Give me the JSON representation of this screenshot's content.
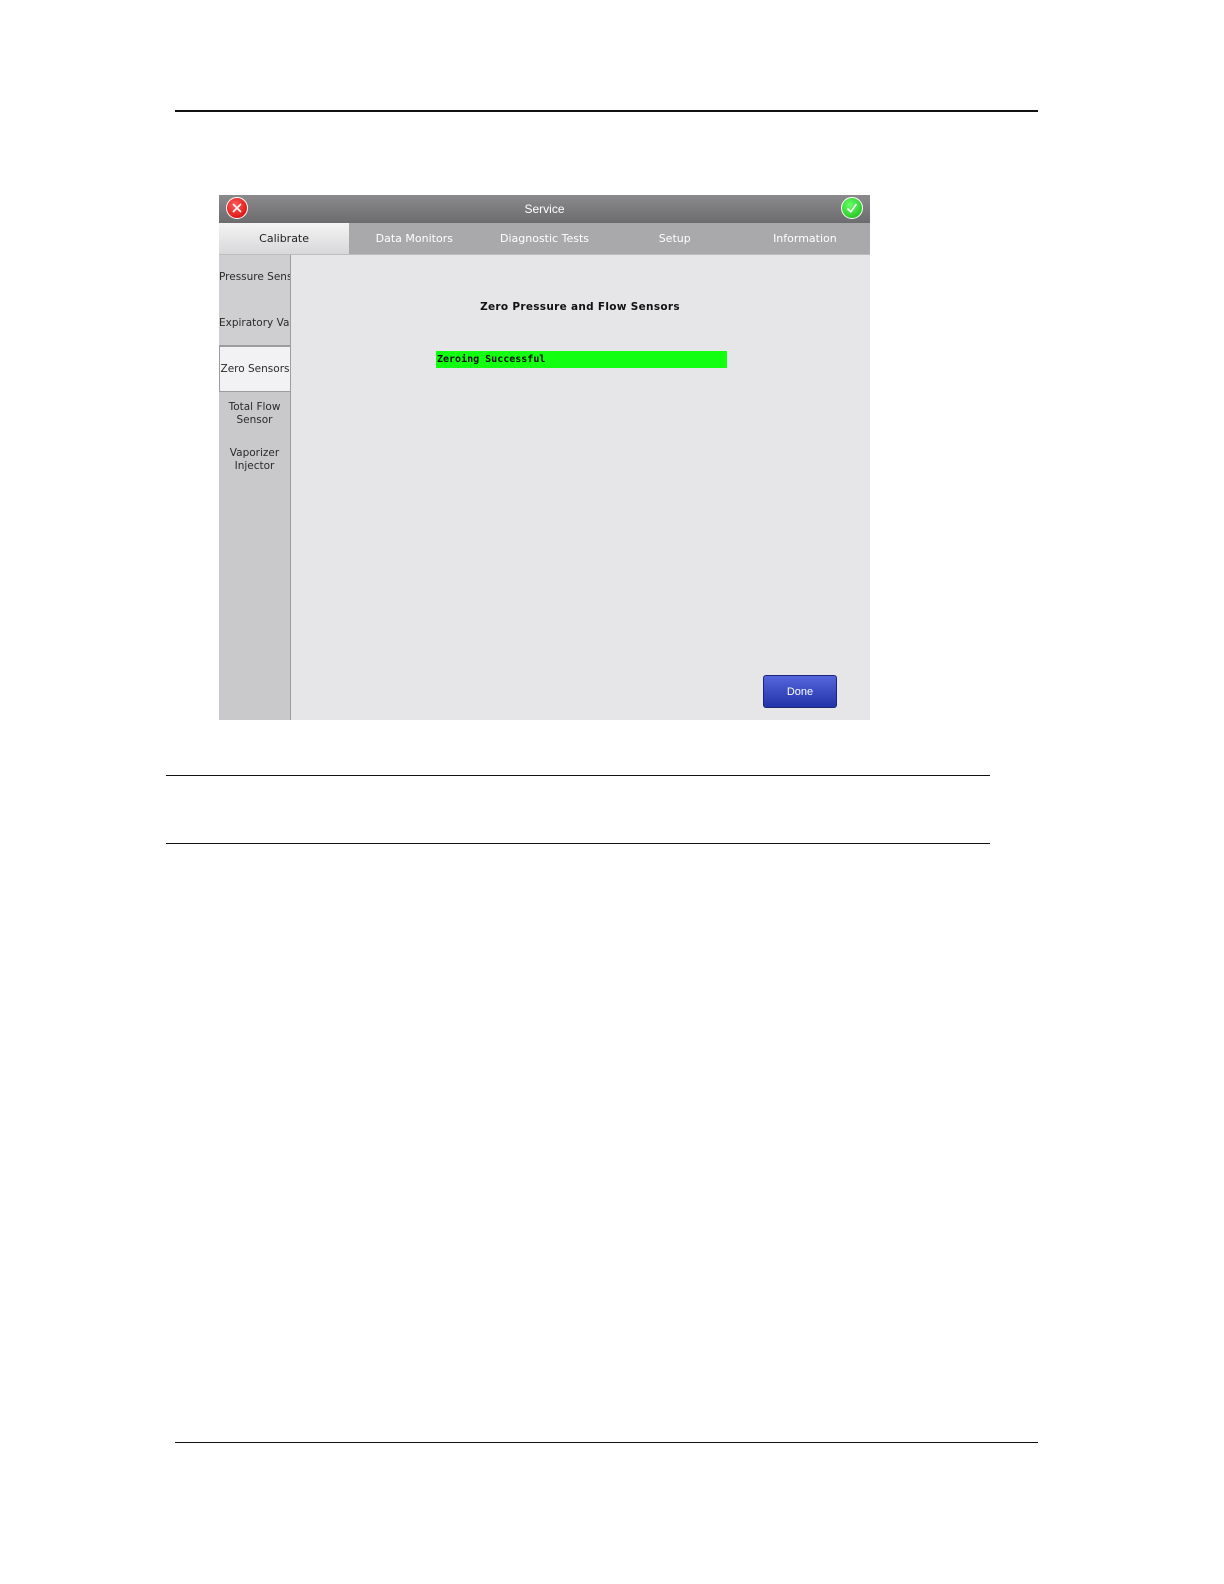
{
  "window": {
    "title": "Service",
    "cancel_icon": "cancel-x-icon",
    "confirm_icon": "check-icon",
    "colors": {
      "cancel": "#d20000",
      "confirm": "#16b516"
    }
  },
  "tabs": [
    {
      "label": "Calibrate",
      "active": true
    },
    {
      "label": "Data Monitors",
      "active": false
    },
    {
      "label": "Diagnostic Tests",
      "active": false
    },
    {
      "label": "Setup",
      "active": false
    },
    {
      "label": "Information",
      "active": false
    }
  ],
  "sidebar": {
    "items": [
      {
        "label": "Pressure Sensor"
      },
      {
        "label": "Expiratory Valve"
      },
      {
        "label": "Zero Sensors",
        "active": true
      },
      {
        "label_line1": "Total Flow",
        "label_line2": "Sensor"
      },
      {
        "label_line1": "Vaporizer",
        "label_line2": "Injector"
      }
    ]
  },
  "panel": {
    "title": "Zero Pressure and Flow Sensors",
    "status": "Zeroing Successful",
    "status_color": "#12ff12",
    "done_label": "Done"
  }
}
